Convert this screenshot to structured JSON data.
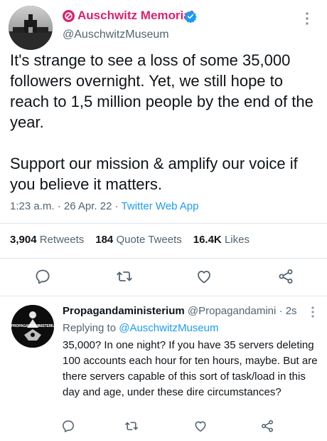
{
  "tweet": {
    "display_name": "Auschwitz Memorial",
    "handle": "@AuschwitzMuseum",
    "text": "It's strange to see a loss of some 35,000 followers overnight. Yet, we still hope to reach to 1,5 million people by the end of the year.\n\nSupport our mission & amplify our voice if you believe it matters.",
    "time": "1:23 a.m.",
    "date": "26 Apr. 22",
    "source_app": "Twitter Web App",
    "retweets_count": "3,904",
    "retweets_label": "Retweets",
    "quotes_count": "184",
    "quotes_label": "Quote Tweets",
    "likes_count": "16.4K",
    "likes_label": "Likes"
  },
  "reply": {
    "display_name": "Propagandaministerium",
    "handle": "@Propagandamini",
    "time_ago": "2s",
    "replying_prefix": "Replying to",
    "replying_to": "@AuschwitzMuseum",
    "text": "35,000?  In one night?  If you have 35 servers deleting 100 accounts each hour for ten hours, maybe.  But are there servers capable of this sort of task/load in this day and age, under these dire circumstances?",
    "avatar_text": "PROPAGANDAMINISTERIUM"
  },
  "icons": {
    "reply": "reply-icon",
    "retweet": "retweet-icon",
    "like": "like-icon",
    "share": "share-icon",
    "more": "more-icon",
    "verified": "verified-badge-icon",
    "affiliate": "affiliate-badge-icon"
  },
  "colors": {
    "brand_name": "#d6246e",
    "link": "#1d9bf0",
    "secondary_text": "#536471",
    "primary_text": "#0f1419",
    "divider": "#e1e6ea"
  }
}
